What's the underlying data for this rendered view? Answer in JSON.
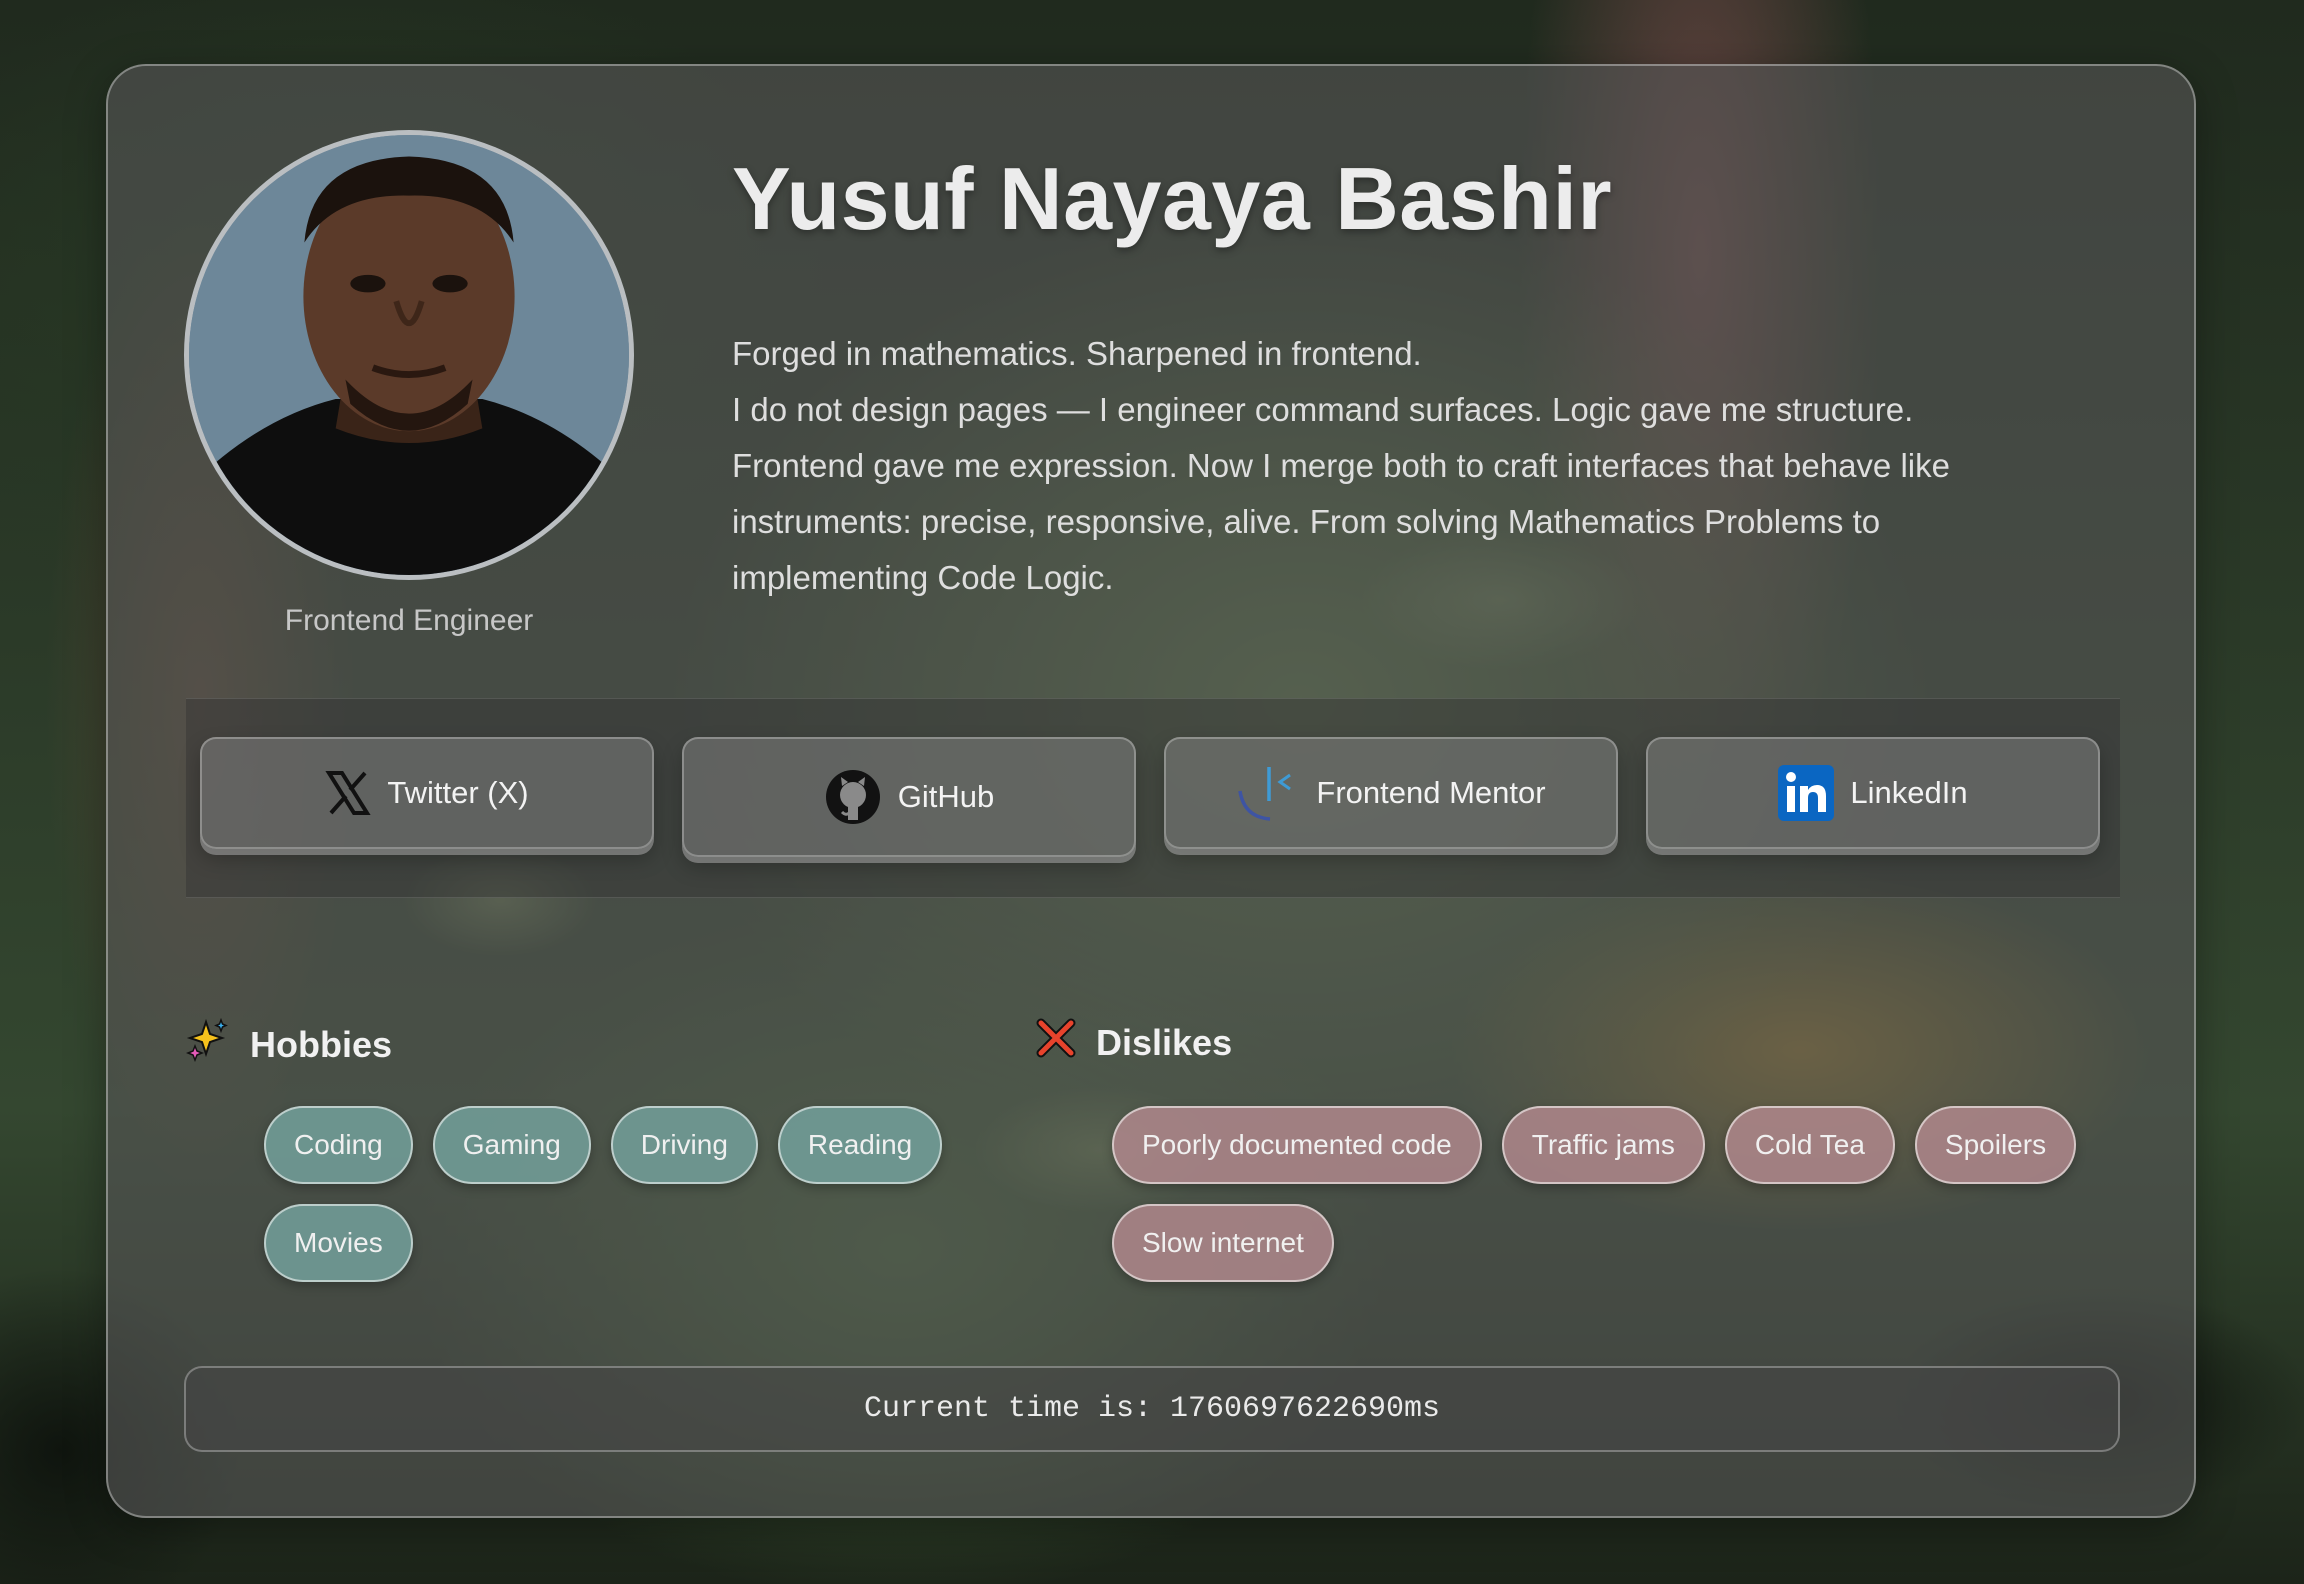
{
  "profile": {
    "name": "Yusuf Nayaya Bashir",
    "role": "Frontend Engineer",
    "bio_line1": "Forged in mathematics. Sharpened in frontend.",
    "bio_line2": "I do not design pages — I engineer command surfaces. Logic gave me structure. Frontend gave me expression. Now I merge both to craft interfaces that behave like instruments: precise, responsive, alive. From solving Mathematics Problems to implementing Code Logic."
  },
  "social": {
    "twitter": {
      "label": "Twitter (X)",
      "icon": "x-logo-icon"
    },
    "github": {
      "label": "GitHub",
      "icon": "github-octocat-icon"
    },
    "frontend_mentor": {
      "label": "Frontend Mentor",
      "icon": "frontend-mentor-icon"
    },
    "linkedin": {
      "label": "LinkedIn",
      "icon": "linkedin-icon",
      "color": "#0a66c2"
    }
  },
  "hobbies": {
    "title": "Hobbies",
    "icon": "sparkles-icon",
    "items": [
      "Coding",
      "Gaming",
      "Driving",
      "Reading",
      "Movies"
    ]
  },
  "dislikes": {
    "title": "Dislikes",
    "icon": "cross-mark-icon",
    "items": [
      "Poorly documented code",
      "Traffic jams",
      "Cold Tea",
      "Spoilers",
      "Slow internet"
    ]
  },
  "clock": {
    "prefix": "Current time is: ",
    "value": "1760697622690ms"
  }
}
